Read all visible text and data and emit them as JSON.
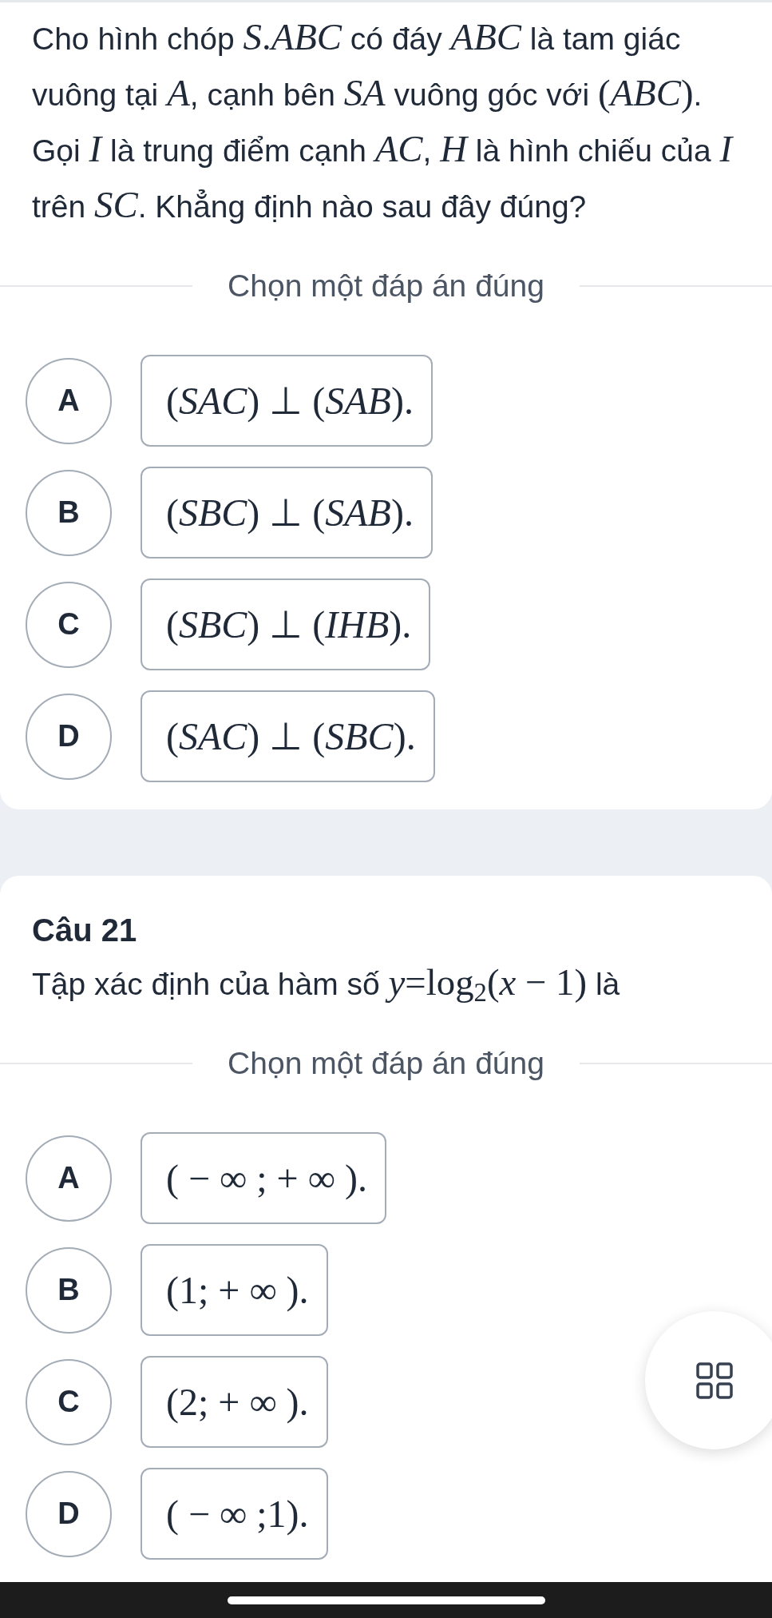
{
  "questions": [
    {
      "text": [
        {
          "kind": "text",
          "text": "Cho hình chóp "
        },
        {
          "kind": "math",
          "text": "*S*.*ABC*"
        },
        {
          "kind": "text",
          "text": " có đáy "
        },
        {
          "kind": "math",
          "text": "*ABC*"
        },
        {
          "kind": "text",
          "text": " là tam giác vuông tại "
        },
        {
          "kind": "math",
          "text": "*A*"
        },
        {
          "kind": "text",
          "text": ", cạnh bên "
        },
        {
          "kind": "math",
          "text": "*SA*"
        },
        {
          "kind": "text",
          "text": " vuông góc với "
        },
        {
          "kind": "math",
          "text": "(*ABC*)"
        },
        {
          "kind": "text",
          "text": ". Gọi "
        },
        {
          "kind": "math",
          "text": "*I*"
        },
        {
          "kind": "text",
          "text": " là trung điểm cạnh "
        },
        {
          "kind": "math",
          "text": "*AC*"
        },
        {
          "kind": "text",
          "text": ", "
        },
        {
          "kind": "math",
          "text": "*H*"
        },
        {
          "kind": "text",
          "text": " là hình chiếu của "
        },
        {
          "kind": "math",
          "text": "*I*"
        },
        {
          "kind": "text",
          "text": " trên "
        },
        {
          "kind": "math",
          "text": "*SC*"
        },
        {
          "kind": "text",
          "text": ". Khẳng định nào sau đây đúng?"
        }
      ],
      "prompt": "Chọn một đáp án đúng",
      "options": [
        {
          "letter": "A",
          "text": "(*SAC*) ⊥ (*SAB*).",
          "selected": false
        },
        {
          "letter": "B",
          "text": "(*SBC*) ⊥ (*SAB*).",
          "selected": false
        },
        {
          "letter": "C",
          "text": "(*SBC*) ⊥ (*IHB*).",
          "selected": false
        },
        {
          "letter": "D",
          "text": "(*SAC*) ⊥ (*SBC*).",
          "selected": false
        }
      ]
    },
    {
      "title": "Câu 21",
      "text": [
        {
          "kind": "text",
          "text": "Tập xác định của hàm số "
        },
        {
          "kind": "math",
          "text": "*y*=log$_{2}$(*x* − 1)"
        },
        {
          "kind": "text",
          "text": " là"
        }
      ],
      "prompt": "Chọn một đáp án đúng",
      "options": [
        {
          "letter": "A",
          "text": "( − ∞ ; + ∞ ).",
          "selected": false
        },
        {
          "letter": "B",
          "text": "(1; + ∞ ).",
          "selected": false
        },
        {
          "letter": "C",
          "text": "(2; + ∞ ).",
          "selected": false
        },
        {
          "letter": "D",
          "text": "( − ∞ ;1).",
          "selected": false
        }
      ]
    }
  ]
}
